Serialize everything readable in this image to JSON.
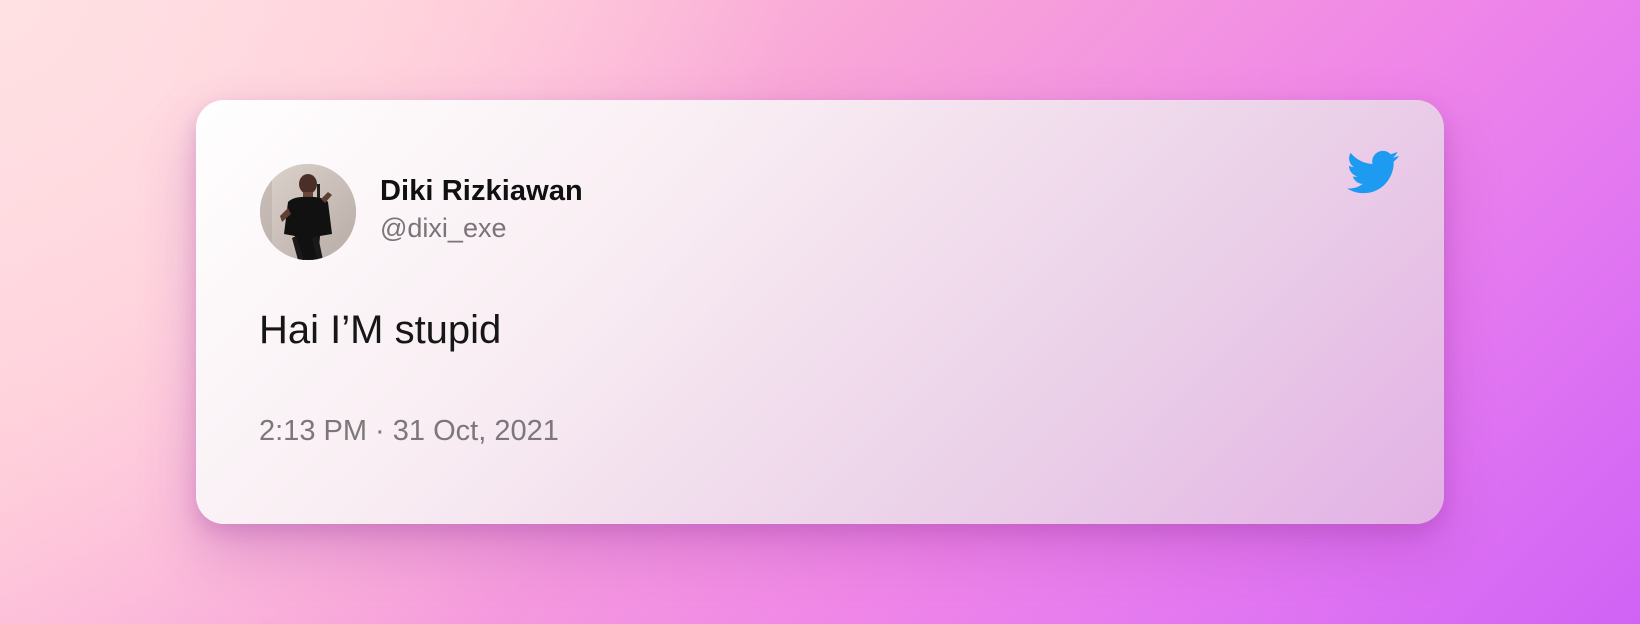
{
  "tweet": {
    "name": "Diki Rizkiawan",
    "handle": "@dixi_exe",
    "text": "Hai I’M stupid",
    "timestamp": "2:13 PM · 31 Oct, 2021"
  },
  "icons": {
    "brand": "twitter-bird-icon",
    "avatar": "profile-avatar"
  },
  "colors": {
    "twitter_blue": "#1d9bf0",
    "name": "#101010",
    "secondary_text": "#7a7478",
    "card_start": "#ffffff",
    "card_end": "#e3b9e3"
  }
}
